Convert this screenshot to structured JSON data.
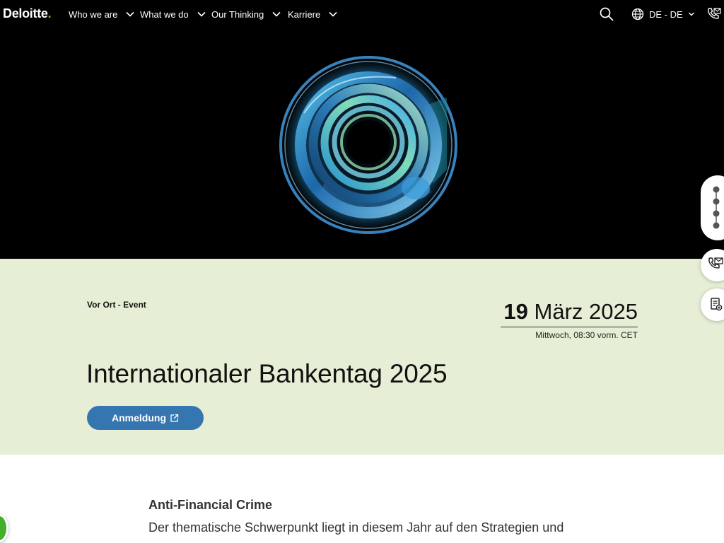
{
  "nav": {
    "logo_text": "Deloitte",
    "logo_dot": ".",
    "items": [
      {
        "label": "Who we are"
      },
      {
        "label": "What we do"
      },
      {
        "label": "Our Thinking"
      },
      {
        "label": "Karriere"
      }
    ],
    "language": "DE - DE",
    "icons": [
      "search-icon",
      "globe-icon",
      "chevron-down-icon",
      "contact-phone-icon"
    ]
  },
  "hero": {
    "image": "abstract-glass-ring-graphic"
  },
  "event": {
    "type": "Vor Ort - Event",
    "date_day": "19",
    "date_month_year": "März 2025",
    "date_detail": "Mittwoch, 08:30 vorm. CET",
    "title": "Internationaler Bankentag 2025",
    "register_label": "Anmeldung"
  },
  "content": {
    "heading": "Anti-Financial Crime",
    "text": "Der thematische Schwerpunkt liegt in diesem Jahr auf den Strategien und"
  },
  "side_widgets": [
    "more-options-icon",
    "contact-phone-icon",
    "document-icon"
  ],
  "colors": {
    "brand_green": "#86bc25",
    "band_bg": "#e6efd5",
    "button_blue": "#3576b0",
    "nav_bg": "#000000"
  }
}
